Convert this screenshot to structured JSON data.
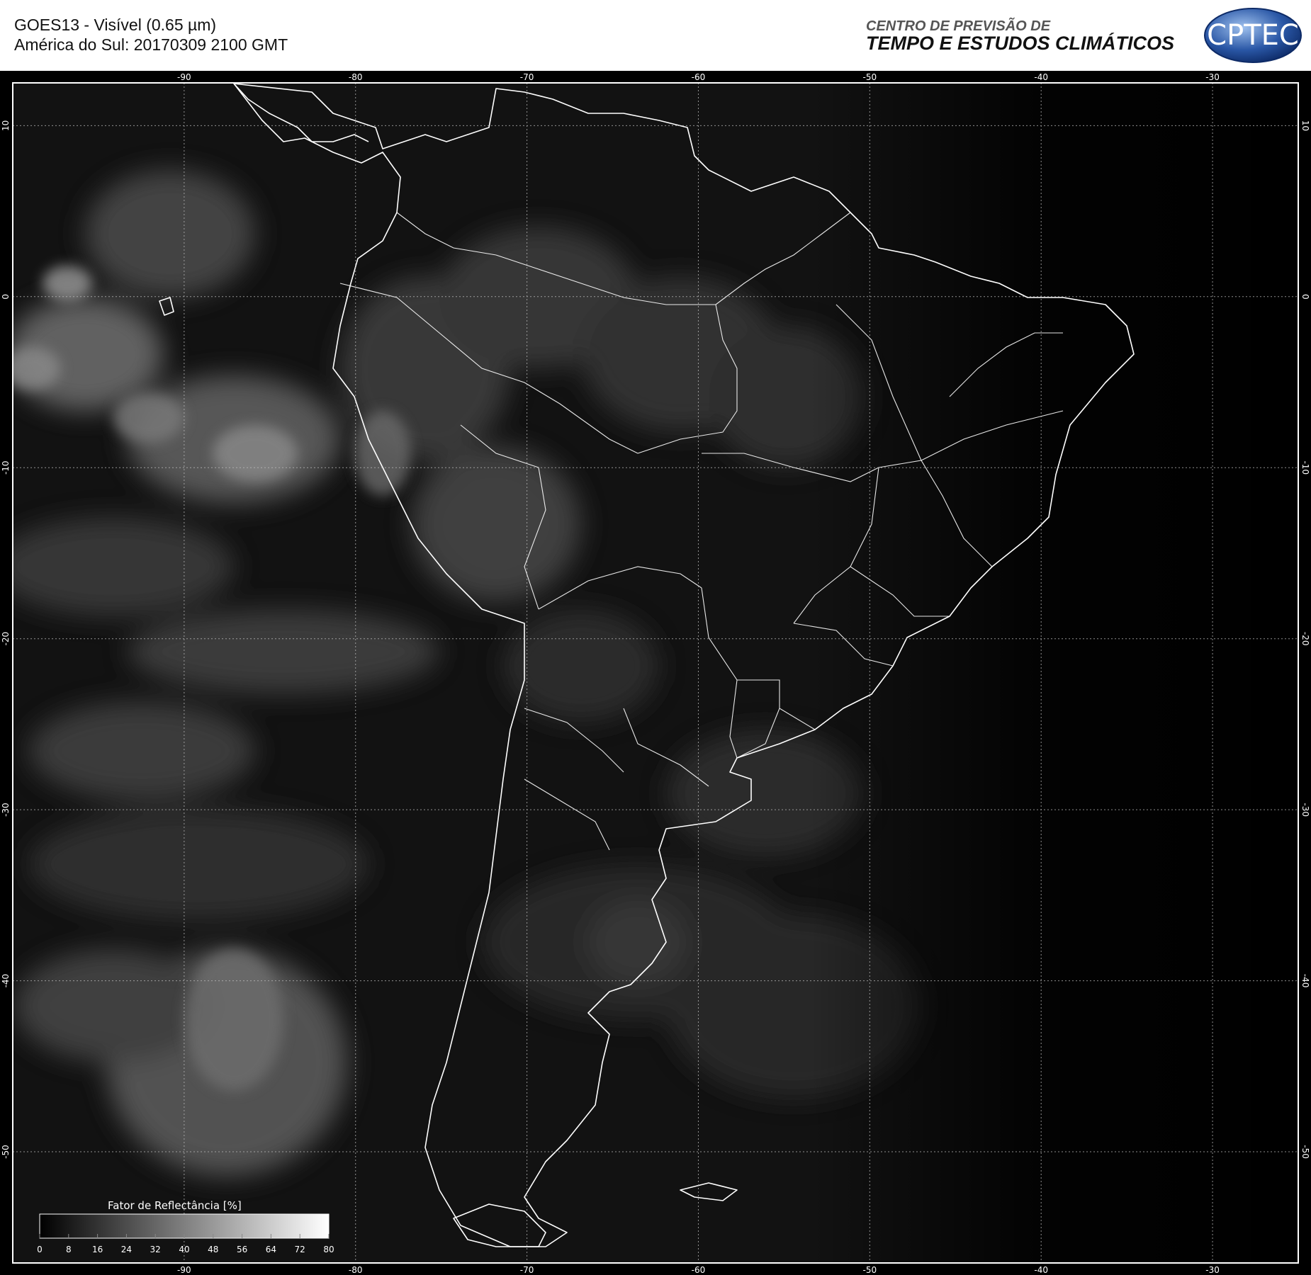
{
  "header": {
    "title_line1": "GOES13 - Visível (0.65 µm)",
    "title_line2": "América do Sul: 20170309 2100 GMT",
    "org_line1": "CENTRO DE PREVISÃO DE",
    "org_line2": "TEMPO E ESTUDOS CLIMÁTICOS",
    "logo_text": "CPTEC"
  },
  "axes": {
    "lon_ticks": [
      "-90",
      "-80",
      "-70",
      "-60",
      "-50",
      "-40",
      "-30"
    ],
    "lat_ticks": [
      "10",
      "0",
      "-10",
      "-20",
      "-30",
      "-40",
      "-50"
    ],
    "lon_values": [
      -90,
      -80,
      -70,
      -60,
      -50,
      -40,
      -30
    ],
    "lat_values": [
      10,
      0,
      -10,
      -20,
      -30,
      -40,
      -50
    ],
    "lon_range": [
      -100,
      -25
    ],
    "lat_range": [
      12.5,
      -56.5
    ]
  },
  "legend": {
    "title": "Fator de Reflectância [%]",
    "ticks": [
      "0",
      "8",
      "16",
      "24",
      "32",
      "40",
      "48",
      "56",
      "64",
      "72",
      "80"
    ]
  },
  "colors": {
    "background": "#000000",
    "coastline": "#ffffff",
    "grid": "#bdbdbd",
    "logo_blue": "#2a57a6"
  }
}
